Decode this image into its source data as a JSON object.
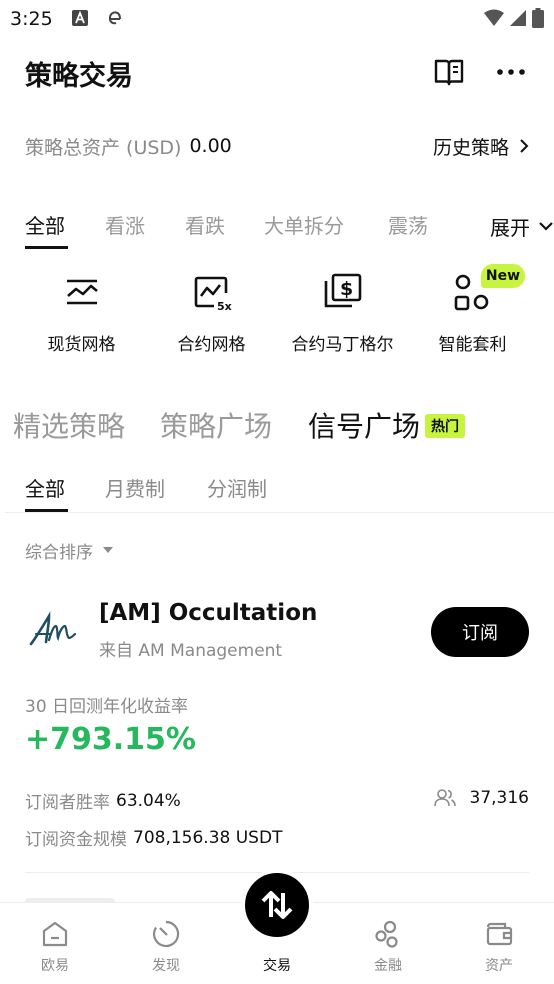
{
  "status_bar": {
    "time": "3:25",
    "app_icons": [
      "a-icon",
      "edge-browser-icon"
    ],
    "right_icons": [
      "wifi-icon",
      "signal-icon",
      "battery-icon"
    ]
  },
  "header": {
    "title": "策略交易",
    "icons": [
      "guide-book-icon",
      "more-options-icon"
    ]
  },
  "assets": {
    "label": "策略总资产 (USD)",
    "value": "0.00",
    "history_label": "历史策略"
  },
  "category_tabs": {
    "items": [
      {
        "label": "全部",
        "active": true
      },
      {
        "label": "看涨",
        "active": false
      },
      {
        "label": "看跌",
        "active": false
      },
      {
        "label": "大单拆分",
        "active": false
      },
      {
        "label": "震荡",
        "active": false
      }
    ],
    "expand_label": "展开"
  },
  "strategies": [
    {
      "label": "现货网格",
      "icon": "spot-grid-icon"
    },
    {
      "label": "合约网格",
      "icon": "futures-grid-icon"
    },
    {
      "label": "合约马丁格尔",
      "icon": "futures-martingale-icon"
    },
    {
      "label": "智能套利",
      "icon": "smart-arbitrage-icon",
      "badge": "New"
    }
  ],
  "main_tabs": {
    "items": [
      {
        "label": "精选策略",
        "active": false
      },
      {
        "label": "策略广场",
        "active": false
      },
      {
        "label": "信号广场",
        "active": true
      }
    ],
    "hot_badge": "热门"
  },
  "sub_tabs": [
    {
      "label": "全部",
      "active": true
    },
    {
      "label": "月费制",
      "active": false
    },
    {
      "label": "分润制",
      "active": false
    }
  ],
  "sort": {
    "label": "综合排序"
  },
  "signal_card": {
    "name": "[AM] Occultation",
    "source": "来自 AM Management",
    "subscribe_label": "订阅",
    "roi_label": "30 日回测年化收益率",
    "roi_value": "+793.15%",
    "win_rate_label": "订阅者胜率",
    "win_rate_value": "63.04%",
    "subscribers": "37,316",
    "fund_label": "订阅资金规模",
    "fund_value": "708,156.38 USDT"
  },
  "bottom_nav": [
    {
      "label": "欧易",
      "icon": "home-icon",
      "active": false
    },
    {
      "label": "发现",
      "icon": "discover-icon",
      "active": false
    },
    {
      "label": "交易",
      "icon": "trade-icon",
      "active": true
    },
    {
      "label": "金融",
      "icon": "finance-icon",
      "active": false
    },
    {
      "label": "资产",
      "icon": "wallet-icon",
      "active": false
    }
  ],
  "colors": {
    "accent_green": "#25b85c",
    "badge_lime": "#c6f43f",
    "text_primary": "#111111",
    "text_secondary": "#8a8a8a"
  }
}
